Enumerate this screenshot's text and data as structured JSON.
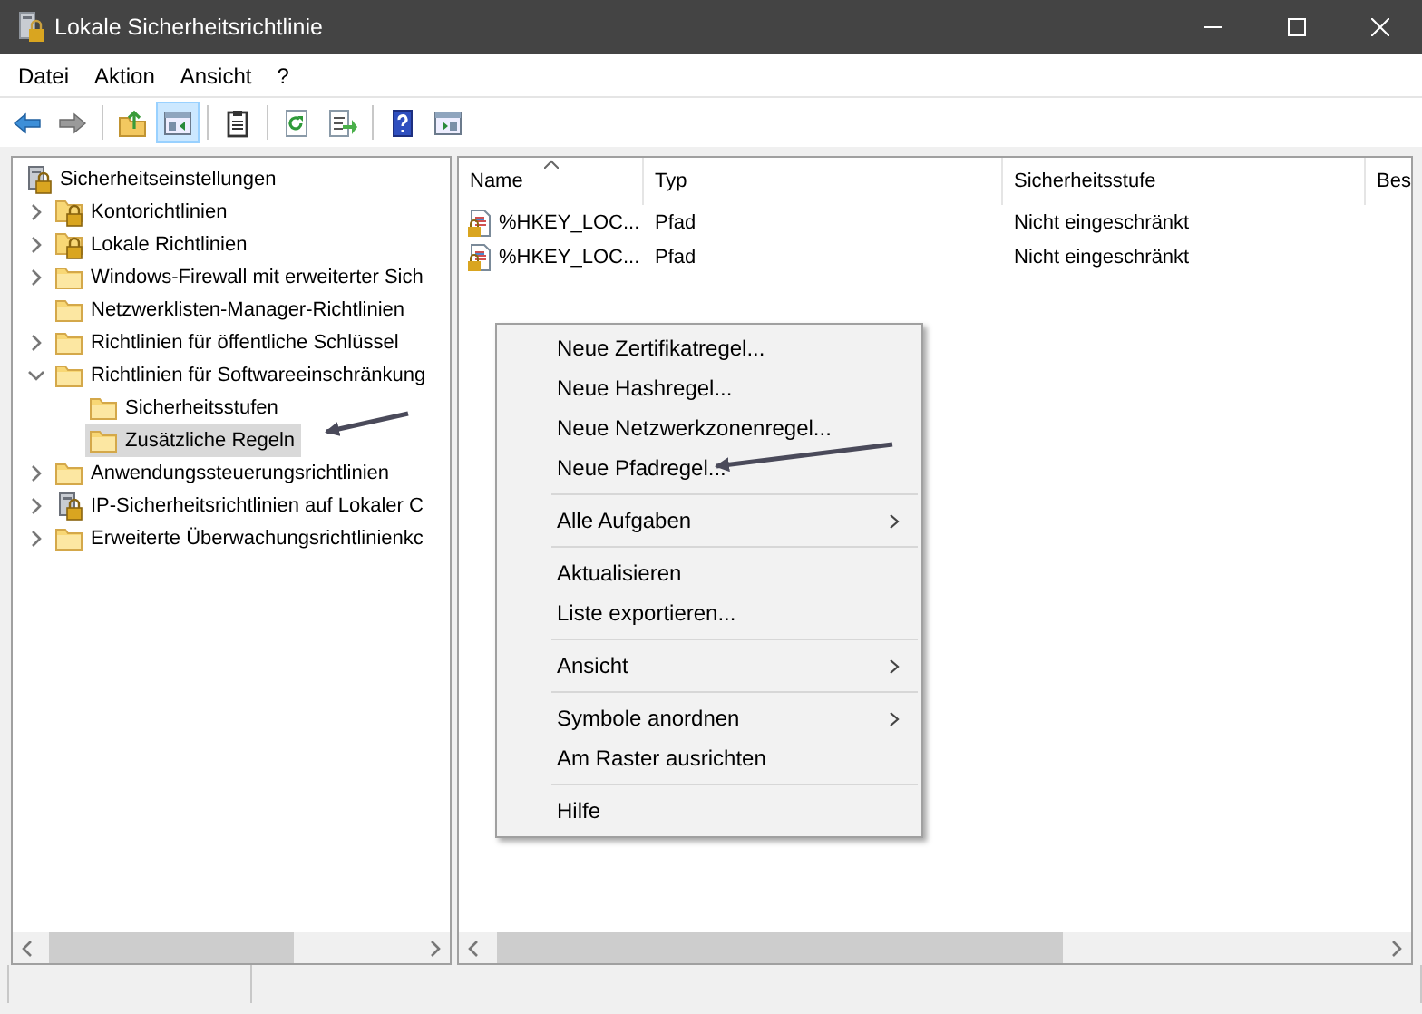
{
  "window": {
    "title": "Lokale Sicherheitsrichtlinie"
  },
  "menu_bar": [
    "Datei",
    "Aktion",
    "Ansicht",
    "?"
  ],
  "toolbar": [
    {
      "kind": "back",
      "pressed": false
    },
    {
      "kind": "forward",
      "pressed": false
    },
    {
      "kind": "separator"
    },
    {
      "kind": "up",
      "pressed": false
    },
    {
      "kind": "tree",
      "pressed": true
    },
    {
      "kind": "separator"
    },
    {
      "kind": "clipboard",
      "pressed": false
    },
    {
      "kind": "separator"
    },
    {
      "kind": "refresh",
      "pressed": false
    },
    {
      "kind": "export",
      "pressed": false
    },
    {
      "kind": "separator"
    },
    {
      "kind": "help",
      "pressed": false
    },
    {
      "kind": "pane",
      "pressed": false
    }
  ],
  "tree": {
    "label": "Sicherheitseinstellungen",
    "kind": "computer-lock",
    "selected": false,
    "children": [
      {
        "label": "Kontorichtlinien",
        "kind": "folder-lock",
        "selected": false,
        "expanded": false
      },
      {
        "label": "Lokale Richtlinien",
        "kind": "folder-lock",
        "selected": false,
        "expanded": false
      },
      {
        "label": "Windows-Firewall mit erweiterter Sich",
        "kind": "folder",
        "selected": false,
        "expanded": false
      },
      {
        "label": "Netzwerklisten-Manager-Richtlinien",
        "kind": "folder",
        "selected": false
      },
      {
        "label": "Richtlinien für öffentliche Schlüssel",
        "kind": "folder",
        "selected": false,
        "expanded": false
      },
      {
        "label": "Richtlinien für Softwareeinschränkung",
        "kind": "folder",
        "selected": false,
        "expanded": true,
        "children": [
          {
            "label": "Sicherheitsstufen",
            "kind": "folder",
            "selected": false
          },
          {
            "label": "Zusätzliche Regeln",
            "kind": "folder",
            "selected": true
          }
        ]
      },
      {
        "label": "Anwendungssteuerungsrichtlinien",
        "kind": "folder",
        "selected": false,
        "expanded": false
      },
      {
        "label": "IP-Sicherheitsrichtlinien auf Lokaler C",
        "kind": "computer-lock",
        "selected": false,
        "expanded": false
      },
      {
        "label": "Erweiterte Überwachungsrichtlinienkc",
        "kind": "folder",
        "selected": false,
        "expanded": false
      }
    ]
  },
  "table": {
    "columns": [
      {
        "label": "Name",
        "sorted": true
      },
      {
        "label": "Typ",
        "sorted": false
      },
      {
        "label": "Sicherheitsstufe",
        "sorted": false
      },
      {
        "label": "Bes",
        "sorted": false
      }
    ],
    "rows": [
      [
        "%HKEY_LOC...",
        "Pfad",
        "Nicht eingeschränkt"
      ],
      [
        "%HKEY_LOC...",
        "Pfad",
        "Nicht eingeschränkt"
      ]
    ]
  },
  "context_menu": [
    {
      "kind": "item",
      "label": "Neue Zertifikatregel...",
      "submenu": false
    },
    {
      "kind": "item",
      "label": "Neue Hashregel...",
      "submenu": false
    },
    {
      "kind": "item",
      "label": "Neue Netzwerkzonenregel...",
      "submenu": false
    },
    {
      "kind": "item",
      "label": "Neue Pfadregel...",
      "submenu": false
    },
    {
      "kind": "separator"
    },
    {
      "kind": "item",
      "label": "Alle Aufgaben",
      "submenu": true
    },
    {
      "kind": "separator"
    },
    {
      "kind": "item",
      "label": "Aktualisieren",
      "submenu": false
    },
    {
      "kind": "item",
      "label": "Liste exportieren...",
      "submenu": false
    },
    {
      "kind": "separator"
    },
    {
      "kind": "item",
      "label": "Ansicht",
      "submenu": true
    },
    {
      "kind": "separator"
    },
    {
      "kind": "item",
      "label": "Symbole anordnen",
      "submenu": true
    },
    {
      "kind": "item",
      "label": "Am Raster ausrichten",
      "submenu": false
    },
    {
      "kind": "separator"
    },
    {
      "kind": "item",
      "label": "Hilfe",
      "submenu": false
    }
  ]
}
